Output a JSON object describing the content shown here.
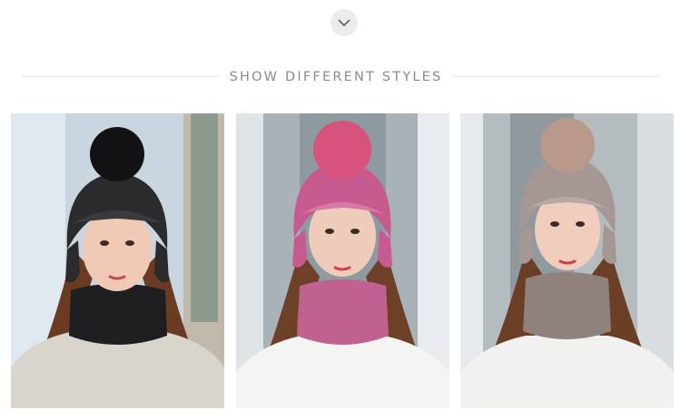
{
  "header": {
    "chevron_icon": "chevron-down-icon",
    "title": "SHOW DIFFERENT STYLES"
  },
  "gallery": {
    "photos": [
      {
        "style": "black",
        "hat_color": "#2b2b2d",
        "pompom_color": "#121214",
        "scarf_color": "#1e1e20",
        "sweater_color": "#d9d4cc",
        "background": "#c6d3de"
      },
      {
        "style": "pink",
        "hat_color": "#c75a8f",
        "pompom_color": "#d6537e",
        "scarf_color": "#c0628f",
        "sweater_color": "#f4f4f2",
        "background": "#a9b3b7"
      },
      {
        "style": "taupe",
        "hat_color": "#a59894",
        "pompom_color": "#b8998a",
        "scarf_color": "#8f817c",
        "sweater_color": "#f1f1ef",
        "background": "#b4bcc0"
      }
    ]
  }
}
